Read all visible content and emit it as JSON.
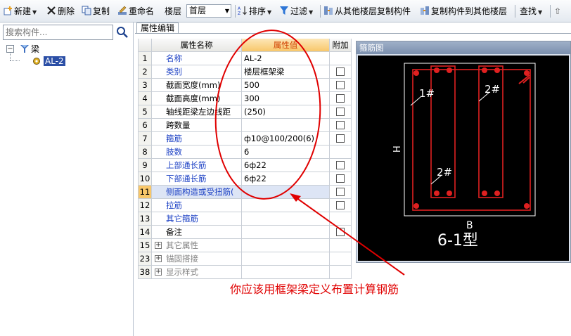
{
  "toolbar": {
    "new_label": "新建",
    "delete_label": "删除",
    "copy_label": "复制",
    "rename_label": "重命名",
    "floor_label": "楼层",
    "floor_value": "首层",
    "sort_label": "排序",
    "filter_label": "过滤",
    "copy_from_floor_label": "从其他楼层复制构件",
    "copy_to_floor_label": "复制构件到其他楼层",
    "find_label": "查找"
  },
  "left_panel": {
    "search_placeholder": "搜索构件...",
    "tree": {
      "root_label": "梁",
      "child_label": "AL-2"
    }
  },
  "tab_label": "属性编辑",
  "grid": {
    "headers": {
      "name": "属性名称",
      "value": "属性值",
      "add": "附加"
    },
    "rows": [
      {
        "num": "1",
        "name": "名称",
        "value": "AL-2",
        "style": "blue",
        "checkbox": false
      },
      {
        "num": "2",
        "name": "类别",
        "value": "楼层框架梁",
        "style": "blue",
        "checkbox": true
      },
      {
        "num": "3",
        "name": "截面宽度(mm)",
        "value": "500",
        "style": "black",
        "checkbox": true
      },
      {
        "num": "4",
        "name": "截面高度(mm)",
        "value": "300",
        "style": "black",
        "checkbox": true
      },
      {
        "num": "5",
        "name": "轴线距梁左边线距",
        "value": "(250)",
        "style": "black",
        "checkbox": true
      },
      {
        "num": "6",
        "name": "跨数量",
        "value": "",
        "style": "black",
        "checkbox": true
      },
      {
        "num": "7",
        "name": "箍筋",
        "value": "ф10@100/200(6)",
        "style": "blue",
        "checkbox": true
      },
      {
        "num": "8",
        "name": "肢数",
        "value": "6",
        "style": "blue",
        "checkbox": false
      },
      {
        "num": "9",
        "name": "上部通长筋",
        "value": "6ф22",
        "style": "blue",
        "checkbox": true
      },
      {
        "num": "10",
        "name": "下部通长筋",
        "value": "6ф22",
        "style": "blue",
        "checkbox": true
      },
      {
        "num": "11",
        "name": "侧面构造或受扭筋(",
        "value": "",
        "style": "blue",
        "checkbox": true,
        "selected": true
      },
      {
        "num": "12",
        "name": "拉筋",
        "value": "",
        "style": "blue",
        "checkbox": true
      },
      {
        "num": "13",
        "name": "其它箍筋",
        "value": "",
        "style": "blue",
        "checkbox": false
      },
      {
        "num": "14",
        "name": "备注",
        "value": "",
        "style": "black",
        "checkbox": true
      },
      {
        "num": "15",
        "name": "其它属性",
        "value": "",
        "style": "gray",
        "expander": true
      },
      {
        "num": "23",
        "name": "锚固搭接",
        "value": "",
        "style": "gray",
        "expander": true
      },
      {
        "num": "38",
        "name": "显示样式",
        "value": "",
        "style": "gray",
        "expander": true
      }
    ]
  },
  "diagram": {
    "title": "箍筋图",
    "labels": {
      "bar1": "1#",
      "bar2_top": "2#",
      "bar2_bottom": "2#",
      "height": "H",
      "width": "B",
      "type": "6-1型"
    }
  },
  "annotation": {
    "note": "你应该用框架梁定义布置计算钢筋",
    "color": "#e00000"
  }
}
